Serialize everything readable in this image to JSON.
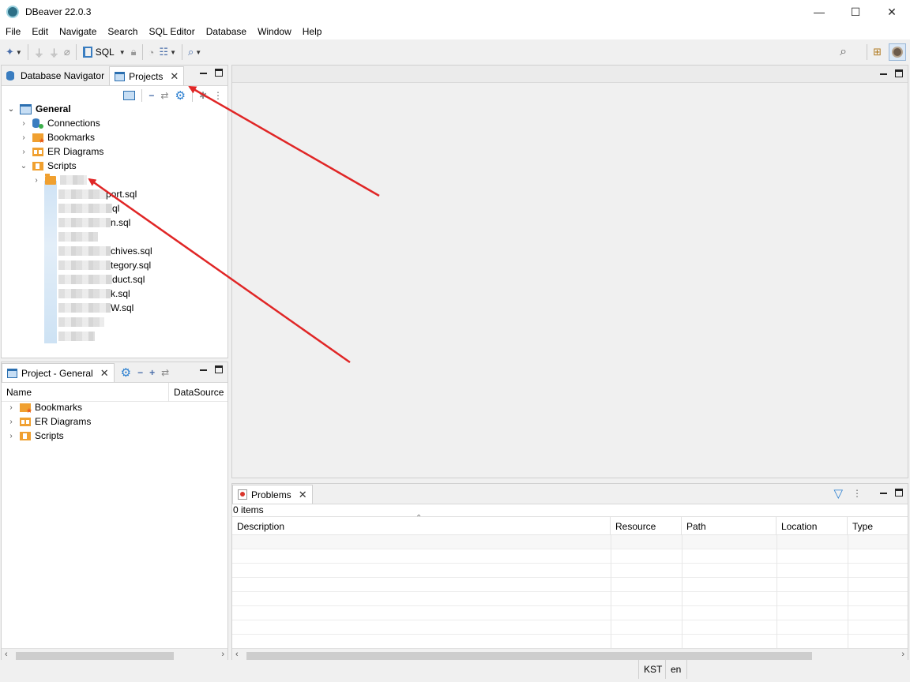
{
  "window": {
    "title": "DBeaver 22.0.3",
    "controls": {
      "minimize": "—",
      "maximize": "☐",
      "close": "✕"
    }
  },
  "menu": [
    "File",
    "Edit",
    "Navigate",
    "Search",
    "SQL Editor",
    "Database",
    "Window",
    "Help"
  ],
  "toolbar": {
    "sql_label": "SQL",
    "icons": [
      "new-connection-icon",
      "connect-icon",
      "disconnect-icon",
      "invalidate-icon",
      "sql-editor-icon",
      "lock-icon",
      "dashboard-icon",
      "schema-icon",
      "search-icon",
      "global-search-icon",
      "open-perspective-icon",
      "perspective-icon"
    ]
  },
  "navigator_panel": {
    "tabs": [
      {
        "label": "Database Navigator",
        "icon": "database-icon",
        "active": false
      },
      {
        "label": "Projects",
        "icon": "project-icon",
        "active": true
      }
    ],
    "tree": {
      "root": "General",
      "items": [
        {
          "label": "Connections",
          "icon": "connections-icon",
          "expanded": false
        },
        {
          "label": "Bookmarks",
          "icon": "bookmarks-icon",
          "expanded": false
        },
        {
          "label": "ER Diagrams",
          "icon": "er-diagrams-icon",
          "expanded": false
        },
        {
          "label": "Scripts",
          "icon": "scripts-icon",
          "expanded": true
        }
      ],
      "scripts_children": [
        {
          "label": "",
          "type": "folder"
        },
        {
          "label": "port.sql"
        },
        {
          "label": "ql"
        },
        {
          "label": "n.sql"
        },
        {
          "label": ""
        },
        {
          "label": "chives.sql"
        },
        {
          "label": "tegory.sql"
        },
        {
          "label": "duct.sql"
        },
        {
          "label": "k.sql"
        },
        {
          "label": "W.sql"
        },
        {
          "label": ""
        },
        {
          "label": ""
        }
      ]
    }
  },
  "project_panel": {
    "tab_label": "Project - General",
    "columns": [
      "Name",
      "DataSource"
    ],
    "items": [
      {
        "label": "Bookmarks",
        "icon": "bookmarks-icon"
      },
      {
        "label": "ER Diagrams",
        "icon": "er-diagrams-icon"
      },
      {
        "label": "Scripts",
        "icon": "scripts-icon"
      }
    ]
  },
  "problems_panel": {
    "tab_label": "Problems",
    "count": "0 items",
    "columns": [
      "Description",
      "Resource",
      "Path",
      "Location",
      "Type"
    ]
  },
  "status": {
    "timezone": "KST",
    "locale": "en"
  },
  "colors": {
    "accent": "#3a7dc0",
    "folder": "#f0a030",
    "annotation_arrow": "#e02626"
  }
}
